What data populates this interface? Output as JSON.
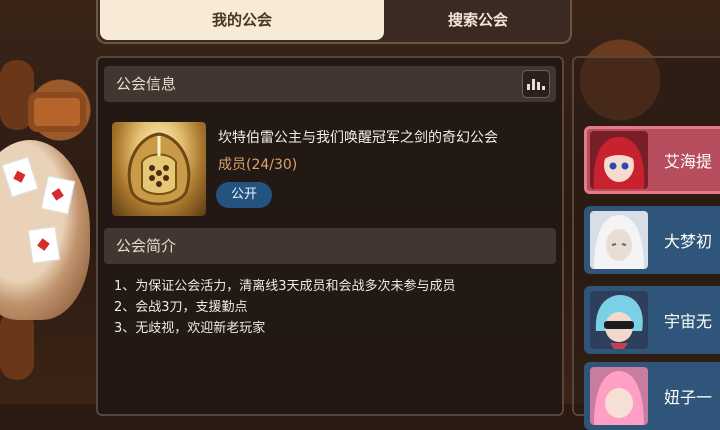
{
  "tabs": {
    "my_guild": "我的公会",
    "search_guild": "搜索公会"
  },
  "info": {
    "header": "公会信息",
    "guild_name": "坎特伯雷公主与我们唤醒冠军之剑的奇幻公会",
    "members": "成员(24/30)",
    "visibility": "公开"
  },
  "intro": {
    "header": "公会简介",
    "lines": [
      "1、为保证公会活力，清离线3天成员和会战多次未参与成员",
      "2、会战3刀，支援勤点",
      "3、无歧视，欢迎新老玩家"
    ]
  },
  "member_list": [
    {
      "name": "艾海提",
      "selected": true
    },
    {
      "name": "大梦初",
      "selected": false
    },
    {
      "name": "宇宙无",
      "selected": false
    },
    {
      "name": "妞子一",
      "selected": false
    }
  ],
  "colors": {
    "accent": "#d9a467",
    "badge": "#24537f",
    "selected_member": "#b64e5d",
    "member_bg": "#2f567a"
  },
  "icons": {
    "stats": "bar-chart-icon",
    "emblem": "golden-helmet-emblem"
  }
}
